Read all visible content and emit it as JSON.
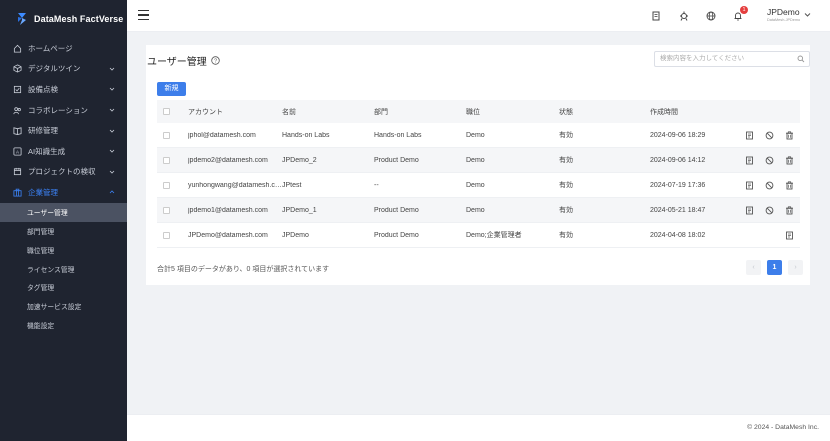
{
  "app": {
    "name": "DataMesh FactVerse"
  },
  "sidebar": {
    "items": [
      {
        "label": "ホームページ",
        "icon": "home-icon",
        "has_children": false
      },
      {
        "label": "デジタルツイン",
        "icon": "cube-icon",
        "has_children": true
      },
      {
        "label": "設備点検",
        "icon": "checklist-icon",
        "has_children": true
      },
      {
        "label": "コラボレーション",
        "icon": "users-icon",
        "has_children": true
      },
      {
        "label": "研修管理",
        "icon": "book-icon",
        "has_children": true
      },
      {
        "label": "AI知識生成",
        "icon": "ai-icon",
        "has_children": true
      },
      {
        "label": "プロジェクトの検収",
        "icon": "calendar-icon",
        "has_children": true
      },
      {
        "label": "企業管理",
        "icon": "briefcase-icon",
        "has_children": true,
        "active": true
      }
    ],
    "subitems": [
      {
        "label": "ユーザー管理",
        "selected": true
      },
      {
        "label": "部門管理"
      },
      {
        "label": "職位管理"
      },
      {
        "label": "ライセンス管理"
      },
      {
        "label": "タグ管理"
      },
      {
        "label": "加速サービス設定"
      },
      {
        "label": "機能設定"
      }
    ]
  },
  "header": {
    "notification_count": "1",
    "user_name": "JPDemo",
    "user_sub": "DataMesh-JPDemo"
  },
  "main": {
    "title": "ユーザー管理",
    "search_placeholder": "検索内容を入力してください",
    "new_button": "新規",
    "columns": [
      "アカウント",
      "名前",
      "部門",
      "職位",
      "状態",
      "作成時間"
    ],
    "rows": [
      {
        "account": "jphol@datamesh.com",
        "name": "Hands-on Labs",
        "dept": "Hands-on Labs",
        "pos": "Demo",
        "state": "有効",
        "time": "2024-09-06 18:29",
        "actions": [
          "edit",
          "disable",
          "delete"
        ]
      },
      {
        "account": "jpdemo2@datamesh.com",
        "name": "JPDemo_2",
        "dept": "Product Demo",
        "pos": "Demo",
        "state": "有効",
        "time": "2024-09-06 14:12",
        "actions": [
          "edit",
          "disable",
          "delete"
        ]
      },
      {
        "account": "yunhongwang@datamesh.com",
        "name": "JPtest",
        "dept": "--",
        "pos": "Demo",
        "state": "有効",
        "time": "2024-07-19 17:36",
        "actions": [
          "edit",
          "disable",
          "delete"
        ]
      },
      {
        "account": "jpdemo1@datamesh.com",
        "name": "JPDemo_1",
        "dept": "Product Demo",
        "pos": "Demo",
        "state": "有効",
        "time": "2024-05-21 18:47",
        "actions": [
          "edit",
          "disable",
          "delete"
        ]
      },
      {
        "account": "JPDemo@datamesh.com",
        "name": "JPDemo",
        "dept": "Product Demo",
        "pos": "Demo;企業管理者",
        "state": "有効",
        "time": "2024-04-08 18:02",
        "actions": [
          "edit"
        ]
      }
    ],
    "summary": "合計5 項目のデータがあり、0 項目が選択されています",
    "pager": {
      "prev": "‹",
      "current": "1",
      "next": "›"
    }
  },
  "footer": {
    "text": "© 2024 - DataMesh Inc."
  },
  "colors": {
    "sidebar_bg": "#1f2430",
    "accent": "#3d7eea",
    "badge": "#e53e3e"
  }
}
